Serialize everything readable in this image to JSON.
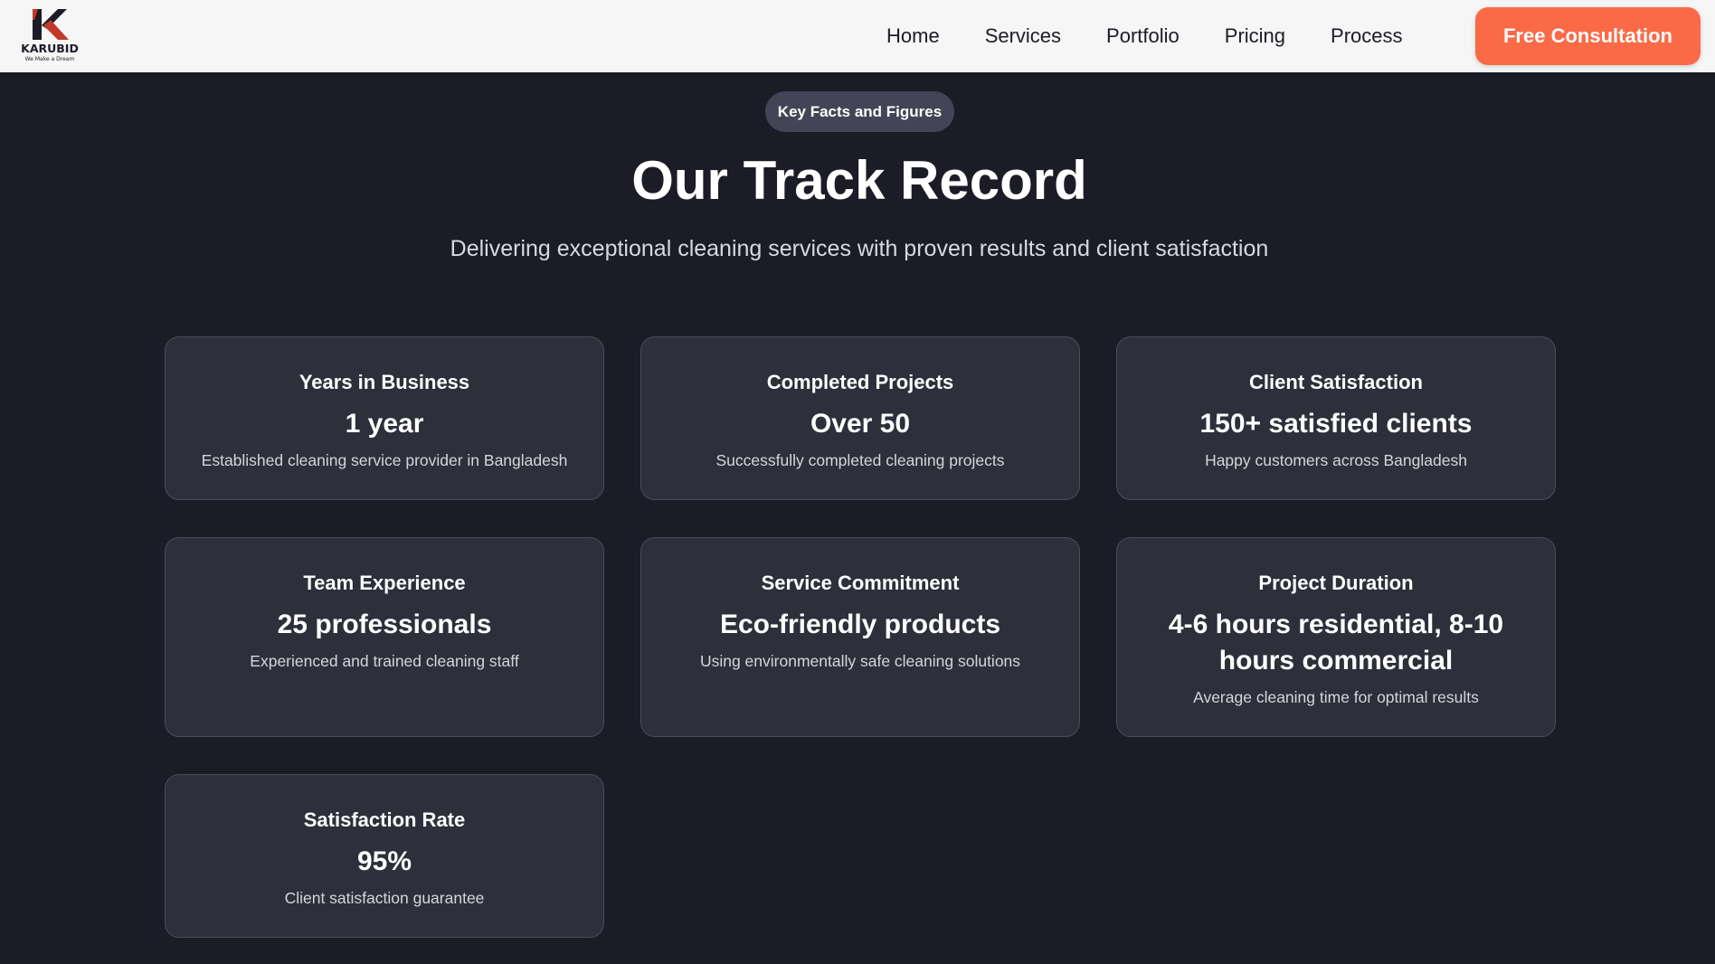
{
  "header": {
    "logo": {
      "wordmark": "KARUBID",
      "tagline": "We Make a Dream"
    },
    "nav": [
      {
        "label": "Home"
      },
      {
        "label": "Services"
      },
      {
        "label": "Portfolio"
      },
      {
        "label": "Pricing"
      },
      {
        "label": "Process"
      }
    ],
    "cta_label": "Free Consultation"
  },
  "hero": {
    "badge": "Key Facts and Figures",
    "title": "Our Track Record",
    "subtitle": "Delivering exceptional cleaning services with proven results and client satisfaction"
  },
  "stats": [
    {
      "title": "Years in Business",
      "value": "1 year",
      "description": "Established cleaning service provider in Bangladesh"
    },
    {
      "title": "Completed Projects",
      "value": "Over 50",
      "description": "Successfully completed cleaning projects"
    },
    {
      "title": "Client Satisfaction",
      "value": "150+ satisfied clients",
      "description": "Happy customers across Bangladesh"
    },
    {
      "title": "Team Experience",
      "value": "25 professionals",
      "description": "Experienced and trained cleaning staff"
    },
    {
      "title": "Service Commitment",
      "value": "Eco-friendly products",
      "description": "Using environmentally safe cleaning solutions"
    },
    {
      "title": "Project Duration",
      "value": "4-6 hours residential, 8-10 hours commercial",
      "description": "Average cleaning time for optimal results"
    },
    {
      "title": "Satisfaction Rate",
      "value": "95%",
      "description": "Client satisfaction guarantee"
    }
  ],
  "colors": {
    "page_background": "#1b1c26",
    "header_background": "#f6f6f6",
    "accent": "#fa6a46",
    "card_background": "#2d2f3b",
    "card_border": "#4a4c5c",
    "badge_background": "#434556"
  }
}
